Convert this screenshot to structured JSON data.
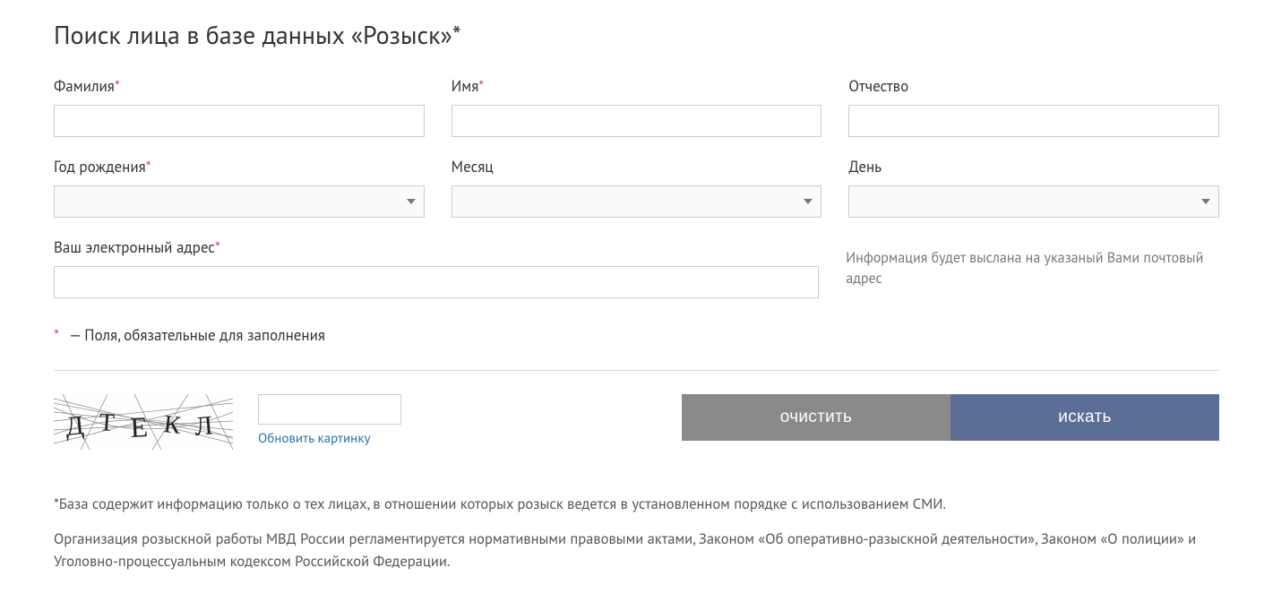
{
  "title": "Поиск лица в базе данных «Розыск»*",
  "fields": {
    "surname": {
      "label": "Фамилия",
      "required": true
    },
    "name": {
      "label": "Имя",
      "required": true
    },
    "patronymic": {
      "label": "Отчество",
      "required": false
    },
    "birth_year": {
      "label": "Год рождения",
      "required": true
    },
    "month": {
      "label": "Месяц",
      "required": false
    },
    "day": {
      "label": "День",
      "required": false
    },
    "email": {
      "label": "Ваш электронный адрес",
      "required": true
    }
  },
  "email_info": "Информация будет выслана на указаный Вами почтовый адрес",
  "required_note_symbol": "*",
  "required_note_text": " — Поля, обязательные для заполнения",
  "captcha": {
    "display": "ДТЕКЛ",
    "refresh_label": "Обновить картинку"
  },
  "buttons": {
    "clear": "очистить",
    "search": "искать"
  },
  "footnotes": {
    "line1": "*База содержит информацию только о тех лицах, в отношении которых розыск ведется в установленном порядке с использованием СМИ.",
    "line2": "Организация розыскной работы МВД России регламентируется нормативными правовыми актами, Законом «Об оперативно-разыскной деятельности», Законом «О полиции» и Уголовно-процессуальным кодексом Российской Федерации."
  }
}
